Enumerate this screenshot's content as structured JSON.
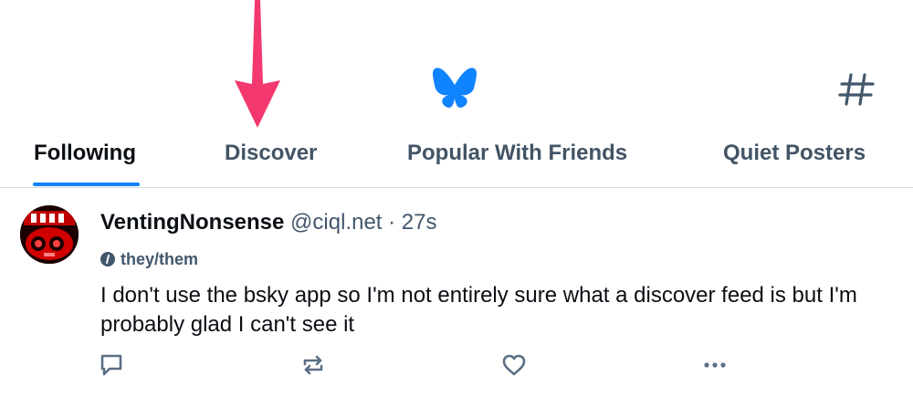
{
  "tabs": [
    {
      "label": "Following",
      "active": true
    },
    {
      "label": "Discover",
      "active": false
    },
    {
      "label": "Popular With Friends",
      "active": false
    },
    {
      "label": "Quiet Posters",
      "active": false
    }
  ],
  "icons": {
    "annotation": "arrow-down-icon",
    "feed_home": "butterfly-icon",
    "feeds": "hashtag-icon"
  },
  "colors": {
    "accent": "#1083fe",
    "annotation_arrow": "#f2386f",
    "text_primary": "#0b0f14",
    "text_secondary": "#42576c"
  },
  "post": {
    "author_name": "VentingNonsense",
    "handle": "@ciql.net",
    "separator": "·",
    "time": "27s",
    "pronouns": "they/them",
    "text": "I don't use the bsky app so I'm not entirely sure what a discover feed is but I'm probably glad I can't see it",
    "actions": [
      "reply-icon",
      "repost-icon",
      "like-icon",
      "more-icon"
    ]
  }
}
